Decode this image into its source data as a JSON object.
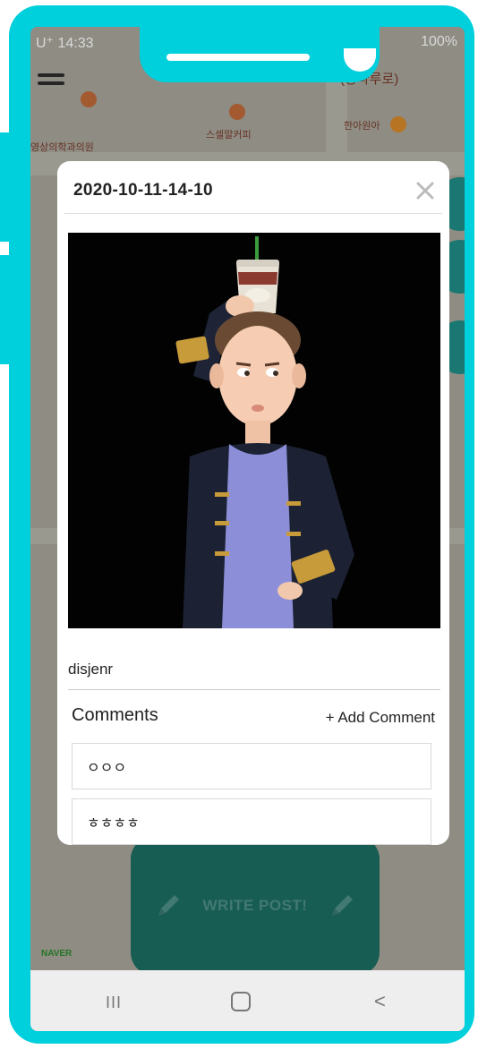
{
  "status_bar": {
    "time": "U⁺ 14:33",
    "battery": "100%"
  },
  "map": {
    "poi_top_right": "(광나루로)",
    "poi_left": "영상의학과의원",
    "poi_cafe": "스셀말커피",
    "poi_right": "한아원아",
    "naver_logo": "NAVER"
  },
  "write_post_label": "WRITE POST!",
  "modal": {
    "title": "2020-10-11-14-10",
    "author": "disjenr",
    "comments_heading": "Comments",
    "add_comment_label": "+ Add Comment",
    "comments": [
      "ㅇㅇㅇ",
      "ㅎㅎㅎㅎ"
    ]
  },
  "navbar": {
    "recent_label": "III",
    "back_label": "<"
  },
  "colors": {
    "frame": "#00cfdc",
    "write_post_bg": "#1c6e63",
    "modal_bg": "#ffffff"
  }
}
